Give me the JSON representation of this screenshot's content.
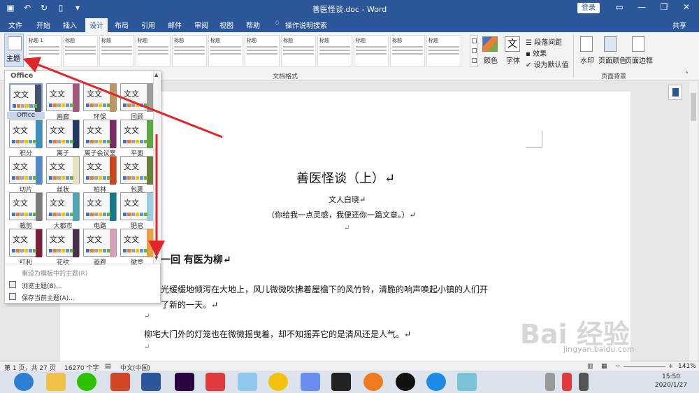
{
  "window": {
    "title": "善医怪谈.doc - Word",
    "login": "登录",
    "share": "共享"
  },
  "tabs": [
    "文件",
    "开始",
    "插入",
    "设计",
    "布局",
    "引用",
    "邮件",
    "审阅",
    "视图",
    "帮助",
    "操作说明搜索"
  ],
  "active_tab": "设计",
  "ribbon": {
    "theme_label": "主题",
    "style_thumbs": [
      "标题 1",
      "标题",
      "标题",
      "标题",
      "标题",
      "标题",
      "标题",
      "标题",
      "标题",
      "标题",
      "标题",
      "标题"
    ],
    "colors": "颜色",
    "fonts_big": "文",
    "fonts": "字体",
    "para_spacing": "段落间距",
    "effects": "效果",
    "set_default": "设为默认值",
    "doc_format_group": "文档格式",
    "watermark": "水印",
    "page_color": "页面颜色",
    "page_border": "页面边框",
    "page_bg_group": "页面背景"
  },
  "document": {
    "title": "善医怪谈（上）↵",
    "author": "文人白晓↵",
    "subtitle": "（你给我一点灵感，我便还你一篇文章。）↵",
    "empty1": "↵",
    "chapter": "一回  有医为柳↵",
    "para1a": "光缓缓地倾泻在大地上，风儿微微吹拂着屋檐下的风竹铃，清脆的响声唤起小镇的人们开",
    "para1b": "了新的一天。↵",
    "empty2": "↵",
    "para2": "柳宅大门外的灯笼也在微微摇曳着，却不知摇弄它的是清风还是人气。↵",
    "empty3": "↵"
  },
  "theme_panel": {
    "header": "Office",
    "themes": [
      {
        "name": "Office",
        "bar": "#44546a",
        "big": "文文"
      },
      {
        "name": "画廊",
        "bar": "#a5567a",
        "big": "文文"
      },
      {
        "name": "环保",
        "bar": "#c09560",
        "big": "文文"
      },
      {
        "name": "回顾",
        "bar": "#9e9e9e",
        "big": "文文"
      },
      {
        "name": "积分",
        "bar": "#3a8fbd",
        "big": "文文"
      },
      {
        "name": "离子",
        "bar": "#1f3864",
        "big": "文文"
      },
      {
        "name": "离子会议室",
        "bar": "#7b2b63",
        "big": "文文"
      },
      {
        "name": "平面",
        "bar": "#5da641",
        "big": "文文"
      },
      {
        "name": "切片",
        "bar": "#4f89c7",
        "big": "文文"
      },
      {
        "name": "丝状",
        "bar": "#e8e1c0",
        "big": "文文"
      },
      {
        "name": "柏林",
        "bar": "#d0421a",
        "big": "文文"
      },
      {
        "name": "包裹",
        "bar": "#6a7f3a",
        "big": "文文"
      },
      {
        "name": "裁剪",
        "bar": "#7a7a7a",
        "big": "文文"
      },
      {
        "name": "大都市",
        "bar": "#4aa5b4",
        "big": "文文"
      },
      {
        "name": "电路",
        "bar": "#157a8a",
        "big": "文文"
      },
      {
        "name": "肥皂",
        "bar": "#9ad0e0",
        "big": "文文"
      },
      {
        "name": "红利",
        "bar": "#7b1e3b",
        "big": "文文"
      },
      {
        "name": "花纹",
        "bar": "#4a2f4d",
        "big": "文文"
      },
      {
        "name": "画廊",
        "bar": "#d9a0b8",
        "big": "文文"
      },
      {
        "name": "徽章",
        "bar": "#e8a33a",
        "big": "文文"
      }
    ],
    "swatches": [
      "#4472c4",
      "#ed7d31",
      "#a5a5a5",
      "#ffc000",
      "#5b9bd5",
      "#70ad47"
    ],
    "reset": "重设为模板中的主题(R)",
    "browse": "浏览主题(B)...",
    "save": "保存当前主题(A)..."
  },
  "statusbar": {
    "page": "第 1 页，共 27 页",
    "words": "16270 个字",
    "lang": "中文(中国)",
    "zoom": "141%"
  },
  "taskbar": {
    "time": "15:50",
    "date": "2020/1/27"
  },
  "watermark": {
    "brand": "Bai 经验",
    "url": "jingyan.baidu.com"
  }
}
